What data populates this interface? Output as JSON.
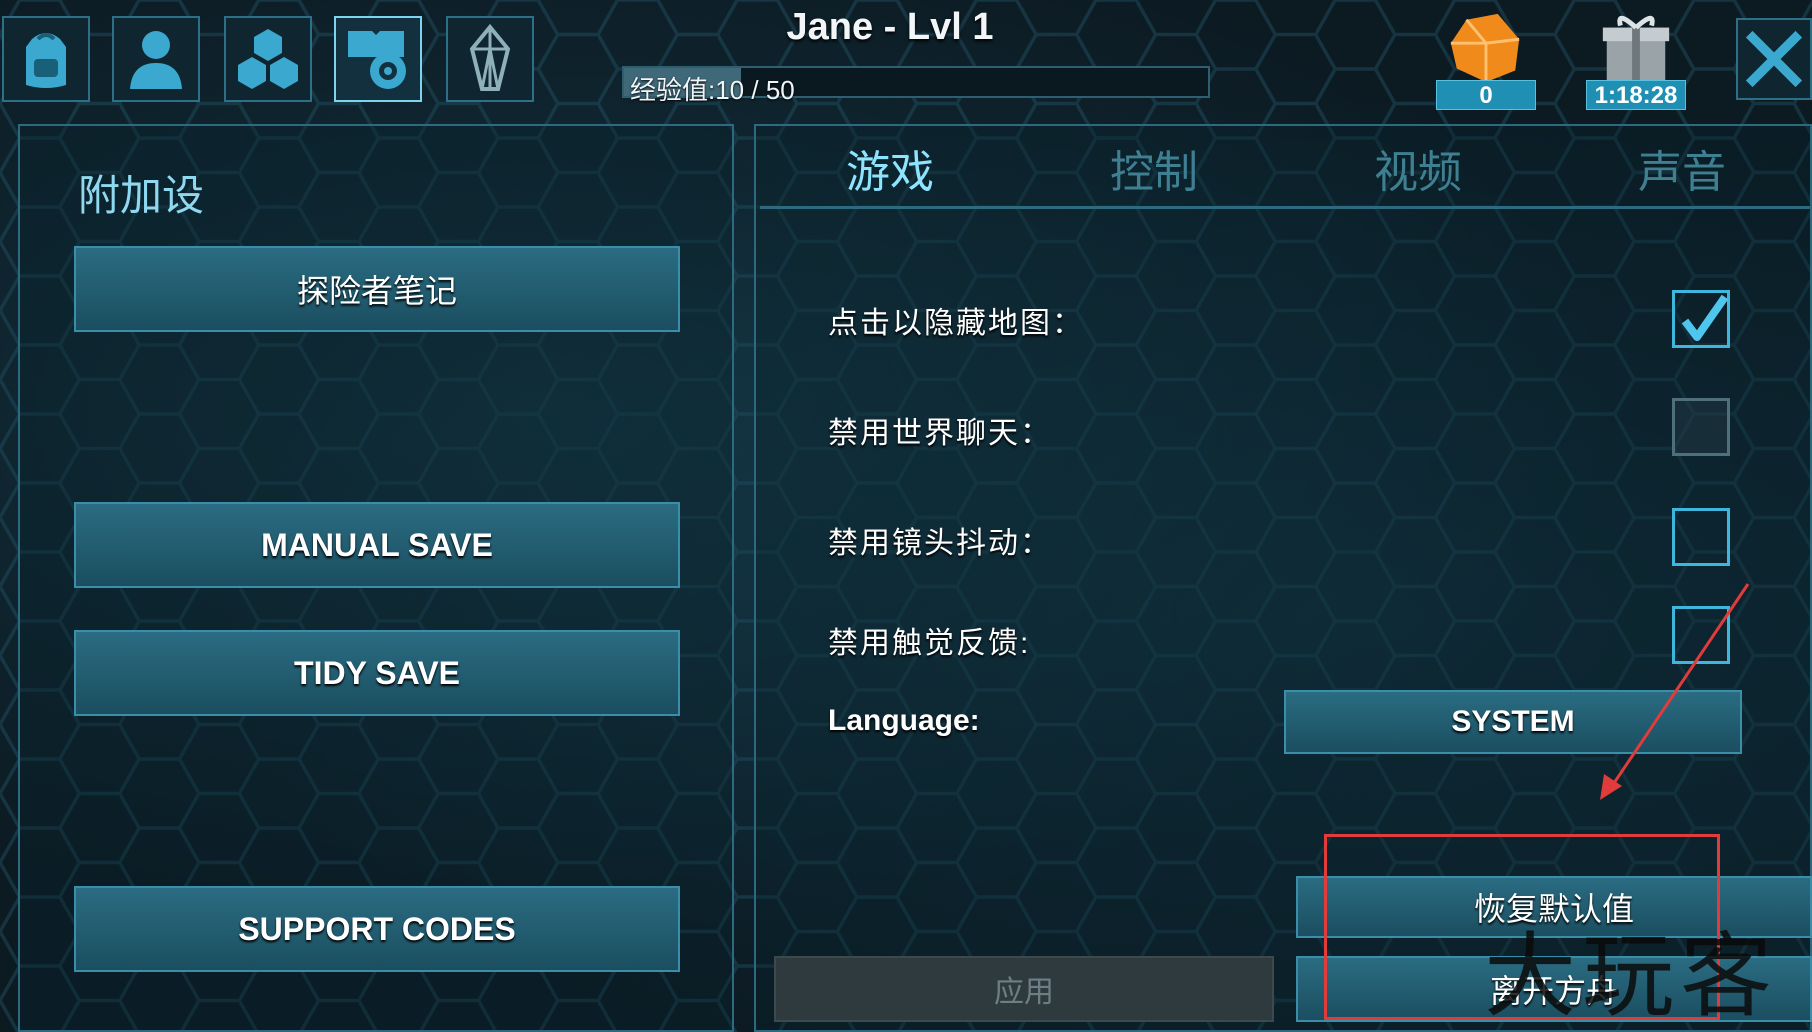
{
  "header": {
    "player_name": "Jane - Lvl 1",
    "xp_label": "经验值:10 / 50",
    "xp_current": 10,
    "xp_max": 50
  },
  "top_nav": [
    {
      "icon": "backpack-icon",
      "active": false
    },
    {
      "icon": "character-icon",
      "active": false
    },
    {
      "icon": "engrams-icon",
      "active": false
    },
    {
      "icon": "settings-book-gear-icon",
      "active": true
    },
    {
      "icon": "tribe-crystal-icon",
      "active": false
    }
  ],
  "currency": {
    "amber_count": "0",
    "gift_timer": "1:18:28"
  },
  "left_panel": {
    "title": "附加设",
    "buttons": {
      "explorer_notes": "探险者笔记",
      "manual_save": "MANUAL SAVE",
      "tidy_save": "TIDY SAVE",
      "support_codes": "SUPPORT CODES"
    }
  },
  "tabs": [
    "游戏",
    "控制",
    "视频",
    "声音"
  ],
  "settings": [
    {
      "label": "点击以隐藏地图：",
      "checked": true
    },
    {
      "label": "禁用世界聊天：",
      "checked": false
    },
    {
      "label": "禁用镜头抖动：",
      "checked": false
    },
    {
      "label": "禁用触觉反馈:",
      "checked": false
    }
  ],
  "language": {
    "label": "Language:",
    "value": "SYSTEM"
  },
  "actions": {
    "restore_defaults": "恢复默认值",
    "apply": "应用",
    "leave_ark": "离开方舟"
  },
  "annotation": {
    "color": "#e13b3b"
  },
  "watermark": "大玩客",
  "colors": {
    "accent": "#3fb6dc",
    "button_fill": "#1f5a6e",
    "tab_active": "#8ee4ff"
  }
}
